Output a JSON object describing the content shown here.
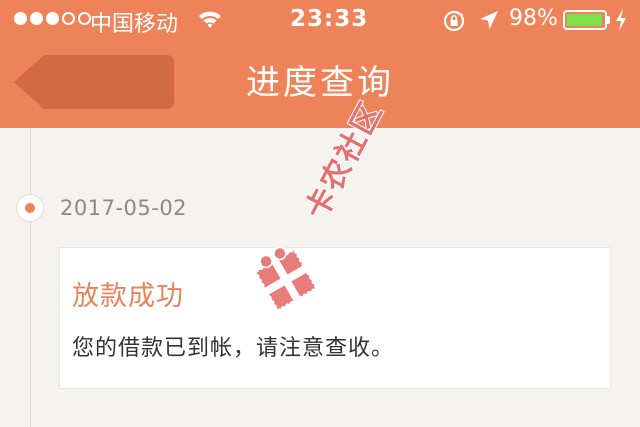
{
  "status_bar": {
    "carrier": "中国移动",
    "time": "23:33",
    "battery_percent": "98%",
    "battery_level": 0.98,
    "signal_bars_on": 3,
    "signal_bars_total": 5,
    "icons": [
      "wifi-icon",
      "rotation-lock-icon",
      "location-arrow-icon",
      "battery-icon",
      "charging-bolt-icon"
    ]
  },
  "header": {
    "title": "进度查询",
    "back_icon": "back-arrow-icon",
    "background_color": "#ee835a"
  },
  "timeline": {
    "accent_color": "#ee835a",
    "entries": [
      {
        "date": "2017-05-02",
        "title": "放款成功",
        "message": "您的借款已到帐，请注意查收。"
      }
    ]
  },
  "watermark": {
    "text": "卡农社区",
    "logo": "gift-box-logo"
  }
}
